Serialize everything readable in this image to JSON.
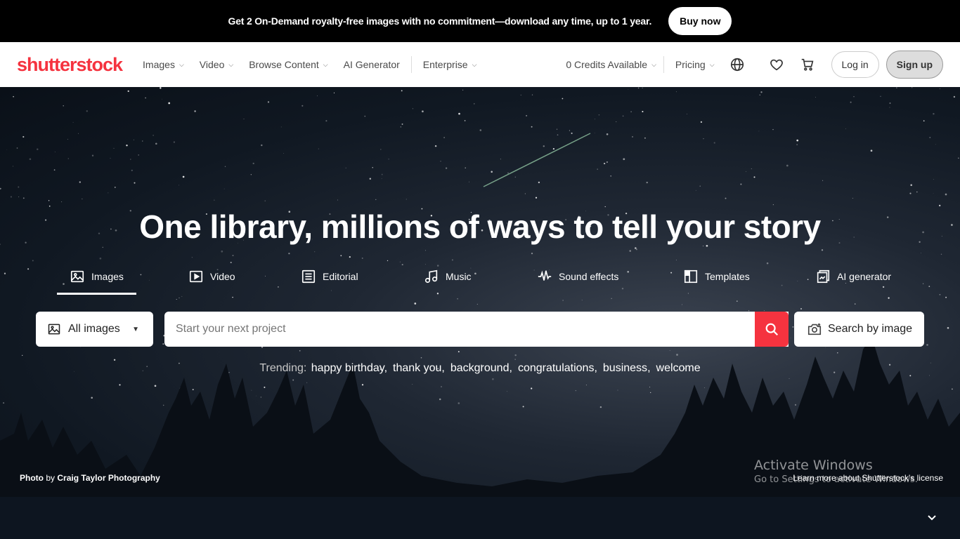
{
  "promo": {
    "text": "Get 2 On-Demand royalty-free images with no commitment—download any time, up to 1 year.",
    "button": "Buy now"
  },
  "nav": {
    "logo": "shutterstock",
    "items": [
      {
        "label": "Images",
        "dropdown": true
      },
      {
        "label": "Video",
        "dropdown": true
      },
      {
        "label": "Browse Content",
        "dropdown": true
      },
      {
        "label": "AI Generator",
        "dropdown": false
      },
      {
        "label": "Enterprise",
        "dropdown": true
      }
    ],
    "credits": "0 Credits Available",
    "pricing": "Pricing",
    "login": "Log in",
    "signup": "Sign up",
    "icons": [
      "globe-icon",
      "heart-icon",
      "cart-icon"
    ]
  },
  "hero": {
    "title": "One library, millions of ways to tell your story",
    "tabs": [
      {
        "label": "Images",
        "icon": "image-icon",
        "active": true
      },
      {
        "label": "Video",
        "icon": "video-icon",
        "active": false
      },
      {
        "label": "Editorial",
        "icon": "editorial-icon",
        "active": false
      },
      {
        "label": "Music",
        "icon": "music-icon",
        "active": false
      },
      {
        "label": "Sound effects",
        "icon": "waveform-icon",
        "active": false
      },
      {
        "label": "Templates",
        "icon": "templates-icon",
        "active": false
      },
      {
        "label": "AI generator",
        "icon": "ai-generator-icon",
        "active": false
      }
    ],
    "type_select": "All images",
    "search_placeholder": "Start your next project",
    "image_search": "Search by image",
    "trending_label": "Trending:",
    "trending": [
      "happy birthday",
      "thank you",
      "background",
      "congratulations",
      "business",
      "welcome"
    ],
    "credit_prefix": "Photo",
    "credit_by": "by",
    "credit_name": "Craig Taylor Photography",
    "license": "Learn more about Shutterstock's license"
  },
  "os_watermark": {
    "line1": "Activate Windows",
    "line2": "Go to Settings to activate Windows."
  },
  "colors": {
    "brand": "#f5333f",
    "promo_bg": "#000000",
    "hero_dark": "#101822"
  }
}
